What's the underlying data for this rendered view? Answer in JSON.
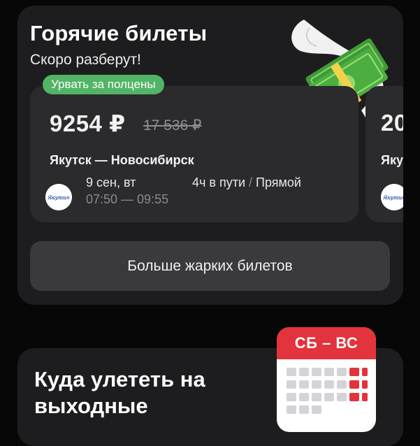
{
  "hot": {
    "title": "Горячие билеты",
    "subtitle": "Скоро разберут!",
    "badge": "Урвать за полцены"
  },
  "tickets": [
    {
      "price": "9254 ₽",
      "old_price": "17 536 ₽",
      "route": "Якутск — Новосибирск",
      "airline_logo_text": "Якутия",
      "date": "9 сен, вт",
      "time": "07:50 — 09:55",
      "duration": "4ч в пути",
      "separator": " / ",
      "transfers": "Прямой"
    },
    {
      "price": "20",
      "route": "Яку",
      "airline_logo_text": "Якутия"
    }
  ],
  "more_button": "Больше жарких билетов",
  "weekend": {
    "title": "Куда улететь на выходные",
    "calendar_label": "СБ – ВС"
  },
  "colors": {
    "badge_green": "#52b466",
    "calendar_red": "#e3333c",
    "background": "#070707",
    "card": "#1d1d1f"
  }
}
